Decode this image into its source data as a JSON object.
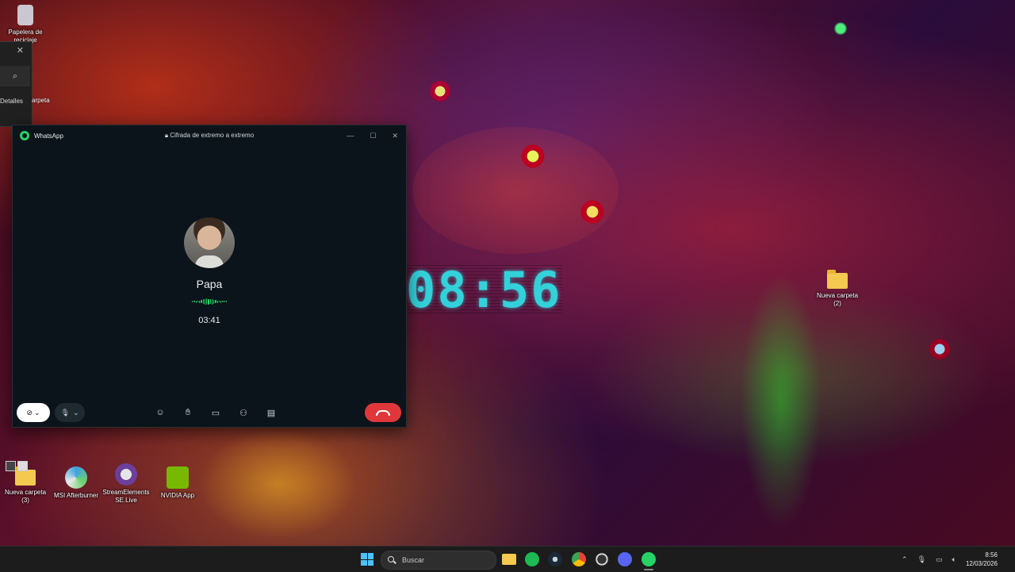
{
  "desktop": {
    "clock_display": "08:56",
    "icons": [
      {
        "label": "Papelera de reciclaje"
      },
      {
        "label": "Nueva carpeta (2)"
      },
      {
        "label": "Nueva carpeta (3)"
      },
      {
        "label": "MSI Afterburner"
      },
      {
        "label": "StreamElements SE.Live"
      },
      {
        "label": "NVIDIA App"
      }
    ]
  },
  "explorer": {
    "details_label": "Detalles",
    "partial_label": "arpeta"
  },
  "whatsapp": {
    "app_name": "WhatsApp",
    "encryption_label": "Cifrada de extremo a extremo",
    "callee_name": "Papa",
    "call_timer": "03:41"
  },
  "taskbar": {
    "search_placeholder": "Buscar",
    "time": "8:56",
    "date": "12/03/2026"
  },
  "colors": {
    "whatsapp_green": "#25d366",
    "hangup_red": "#e0383a",
    "clock_cyan": "#33d1d9"
  }
}
